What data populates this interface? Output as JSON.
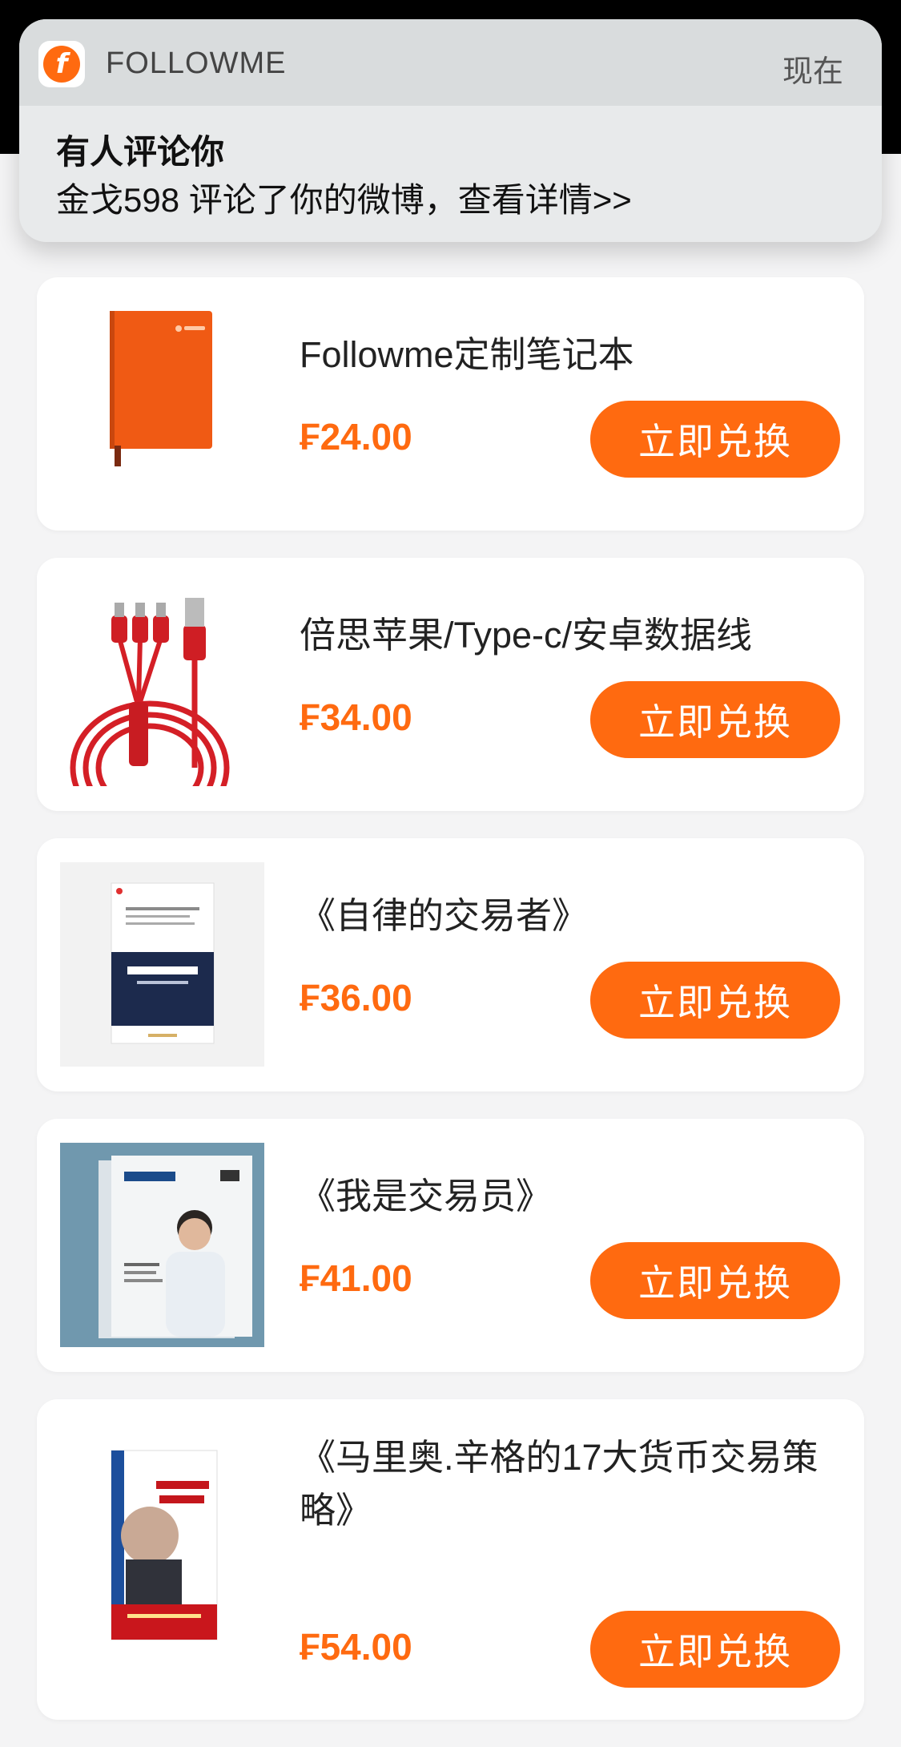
{
  "notification": {
    "app_name": "FOLLOWME",
    "time": "现在",
    "title": "有人评论你",
    "body": "金戈598 评论了你的微博，查看详情>>",
    "icon": "followme-logo-icon",
    "icon_letter": "f"
  },
  "products": [
    {
      "name": "Followme定制笔记本",
      "price": "₣24.00",
      "button": "立即兑换",
      "image": "orange-notebook"
    },
    {
      "name": "倍思苹果/Type-c/安卓数据线",
      "price": "₣34.00",
      "button": "立即兑换",
      "image": "red-usb-cable"
    },
    {
      "name": "《自律的交易者》",
      "price": "₣36.00",
      "button": "立即兑换",
      "image": "book-cover-navy"
    },
    {
      "name": "《我是交易员》",
      "price": "₣41.00",
      "button": "立即兑换",
      "image": "magazine-cover-blue"
    },
    {
      "name": "《马里奥.辛格的17大货币交易策略》",
      "price": "₣54.00",
      "button": "立即兑换",
      "image": "book-cover-white-red"
    }
  ],
  "colors": {
    "accent": "#ff6a10",
    "card_bg": "#ffffff",
    "page_bg": "#f4f4f5"
  }
}
